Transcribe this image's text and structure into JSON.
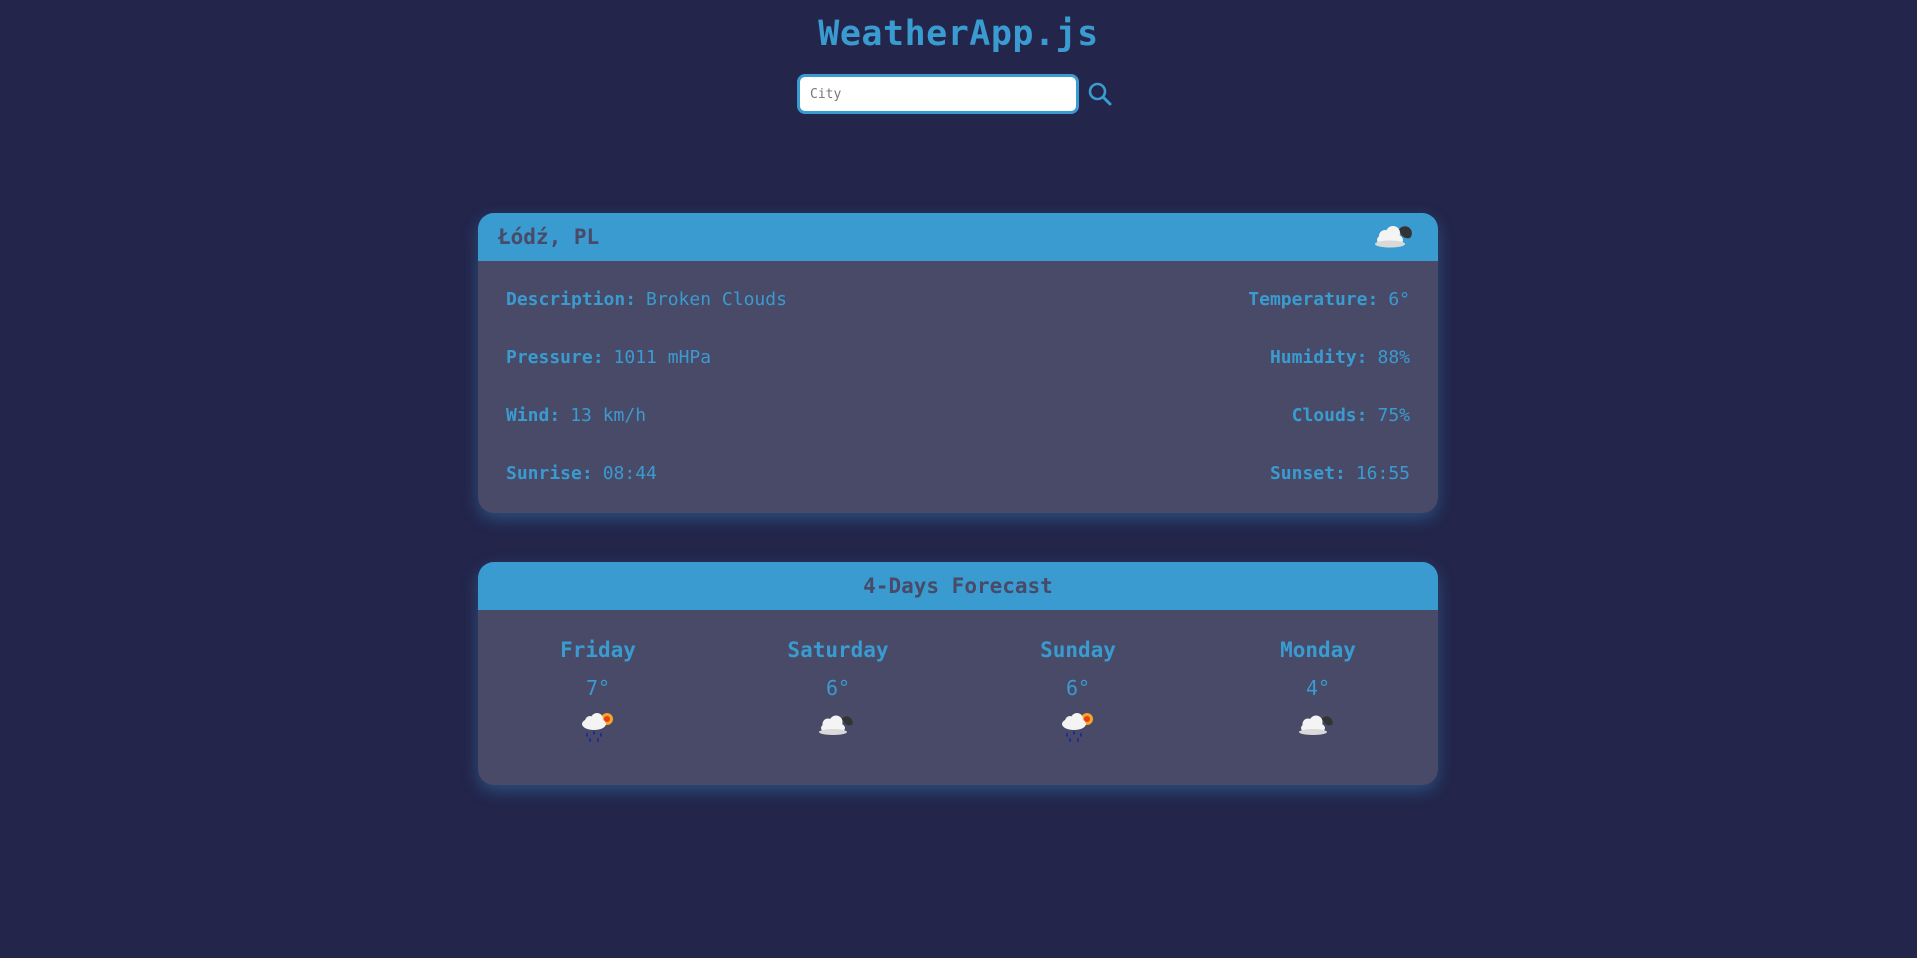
{
  "app": {
    "title": "WeatherApp.js"
  },
  "search": {
    "placeholder": "City",
    "value": "",
    "icon": "search-icon"
  },
  "current": {
    "location": "Łódź, PL",
    "icon": "cloud-moon-icon",
    "details": [
      {
        "label": "Description:",
        "value": "Broken Clouds",
        "side": "left"
      },
      {
        "label": "Temperature:",
        "value": "6°",
        "side": "right"
      },
      {
        "label": "Pressure:",
        "value": "1011 mHPa",
        "side": "left"
      },
      {
        "label": "Humidity:",
        "value": "88%",
        "side": "right"
      },
      {
        "label": "Wind:",
        "value": "13 km/h",
        "side": "left"
      },
      {
        "label": "Clouds:",
        "value": "75%",
        "side": "right"
      },
      {
        "label": "Sunrise:",
        "value": "08:44",
        "side": "left"
      },
      {
        "label": "Sunset:",
        "value": "16:55",
        "side": "right"
      }
    ]
  },
  "forecast": {
    "title": "4-Days Forecast",
    "days": [
      {
        "name": "Friday",
        "temp": "7°",
        "icon": "rain-sun-icon"
      },
      {
        "name": "Saturday",
        "temp": "6°",
        "icon": "cloud-moon-icon"
      },
      {
        "name": "Sunday",
        "temp": "6°",
        "icon": "rain-sun-icon"
      },
      {
        "name": "Monday",
        "temp": "4°",
        "icon": "cloud-moon-icon"
      }
    ]
  },
  "colors": {
    "background": "#23254b",
    "accent": "#3a9bd0",
    "card": "#484a68"
  }
}
